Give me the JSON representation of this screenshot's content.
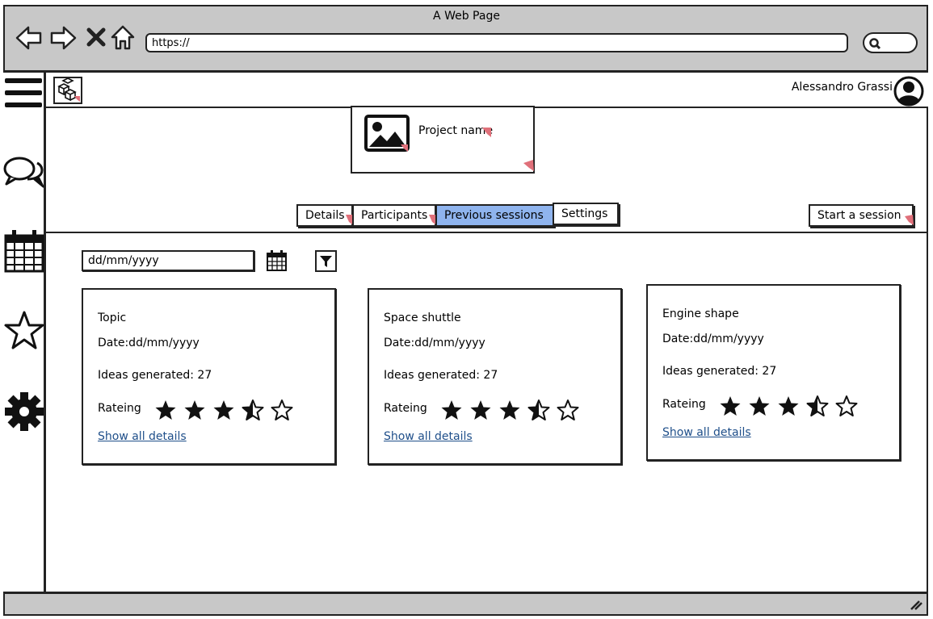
{
  "window": {
    "title": "A Web Page"
  },
  "browser": {
    "url": "https://"
  },
  "header": {
    "user_name": "Alessandro Grassi"
  },
  "project": {
    "name": "Project name"
  },
  "tabs": [
    {
      "label": "Details",
      "active": false
    },
    {
      "label": "Participants",
      "active": false
    },
    {
      "label": "Previous sessions",
      "active": true
    },
    {
      "label": "Settings",
      "active": false
    }
  ],
  "actions": {
    "start_session": "Start a session"
  },
  "filter": {
    "date_placeholder": "dd/mm/yyyy"
  },
  "sessions": [
    {
      "topic": "Topic",
      "date": "Date:dd/mm/yyyy",
      "ideas": "Ideas generated: 27",
      "rating_label": "Rateing",
      "rating": 3.5,
      "rating_max": 5,
      "link": "Show all details"
    },
    {
      "topic": "Space shuttle",
      "date": "Date:dd/mm/yyyy",
      "ideas": "Ideas generated: 27",
      "rating_label": "Rateing",
      "rating": 3.5,
      "rating_max": 5,
      "link": "Show all details"
    },
    {
      "topic": "Engine shape",
      "date": "Date:dd/mm/yyyy",
      "ideas": "Ideas generated: 27",
      "rating_label": "Rateing",
      "rating": 3.5,
      "rating_max": 5,
      "link": "Show all details"
    }
  ],
  "colors": {
    "active_tab": "#8fb4ee",
    "link": "#1f4f8a",
    "chrome": "#c8c8c8",
    "marker": "#e0707a"
  },
  "icons": {
    "nav": [
      "menu-icon",
      "chat-icon",
      "calendar-icon",
      "star-icon",
      "gear-icon"
    ]
  }
}
